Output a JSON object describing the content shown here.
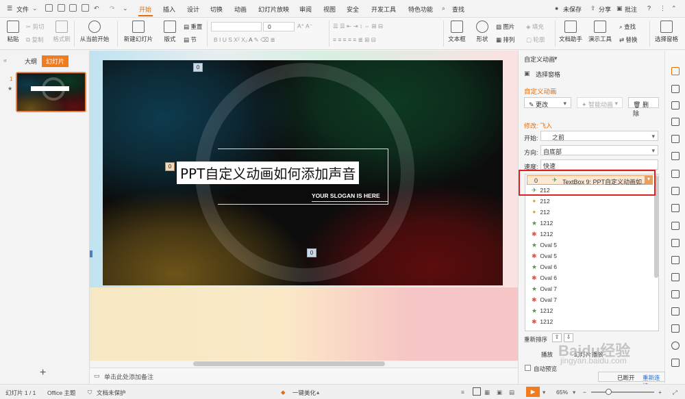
{
  "menubar": {
    "file": "文件",
    "tabs": [
      "开始",
      "插入",
      "设计",
      "切换",
      "动画",
      "幻灯片放映",
      "审阅",
      "视图",
      "安全",
      "开发工具",
      "特色功能"
    ],
    "search": "查找",
    "unsaved": "未保存",
    "share": "分享",
    "comment": "批注",
    "help": "?"
  },
  "ribbon": {
    "paste": "粘贴",
    "cut": "剪切",
    "copy": "复制",
    "format_painter": "格式刷",
    "play_from_current": "从当前开始",
    "new_slide": "新建幻灯片",
    "layout": "版式",
    "reset": "重置",
    "section": "节",
    "font_size": "0",
    "textbox": "文本框",
    "shape": "形状",
    "picture": "图片",
    "fill": "填充",
    "arrange": "排列",
    "outline": "轮廓",
    "text_assistant": "文档助手",
    "presentation_tools": "演示工具",
    "find": "查找",
    "replace": "替换",
    "select_pane": "选择窗格"
  },
  "left_panel": {
    "tab_outline": "大纲",
    "tab_slides": "幻灯片",
    "slide_number": "1",
    "add": "+"
  },
  "slide": {
    "title": "PPT自定义动画如何添加声音",
    "slogan": "YOUR SLOGAN IS HERE",
    "badge_top": "0",
    "badge_title": "0",
    "badge_bottom": "0"
  },
  "notes": {
    "placeholder": "单击此处添加备注"
  },
  "right_panel": {
    "header": "自定义动画",
    "select_pane": "选择窗格",
    "section_title": "自定义动画",
    "change": "更改",
    "smart_animation": "智能动画",
    "delete": "删除",
    "modify": "修改: 飞入",
    "start_label": "开始:",
    "start_value": "之前",
    "direction_label": "方向:",
    "direction_value": "自底部",
    "speed_label": "速度:",
    "speed_value": "快速",
    "selected_item_num": "0",
    "selected_item": "TextBox 9: PPT自定义动画如...",
    "items": [
      "212",
      "212",
      "212",
      "1212",
      "1212",
      "Oval 5",
      "Oval 5",
      "Oval 6",
      "Oval 6",
      "Oval 7",
      "Oval 7",
      "1212",
      "1212"
    ],
    "reorder": "重新排序",
    "play": "播放",
    "slideshow": "幻灯片播放",
    "autopreview": "自动预览"
  },
  "statusbar": {
    "slide_count": "幻灯片 1 / 1",
    "theme": "Office 主题",
    "protect": "文档未保护",
    "beautify": "一键美化",
    "zoom": "65%",
    "connected": "已断开",
    "reconnect": "重新连接"
  },
  "watermark": {
    "line1": "Baidu经验",
    "line2": "jingyan.baidu.com"
  },
  "colors": {
    "accent": "#e46c0a",
    "highlight_box": "#e02020"
  }
}
